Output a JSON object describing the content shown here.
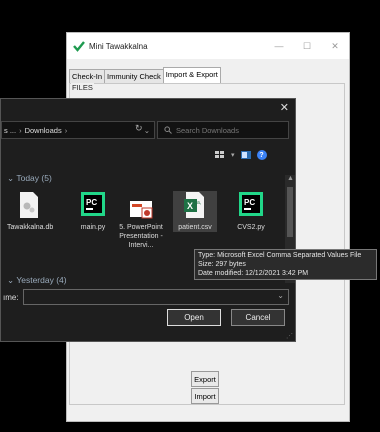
{
  "app": {
    "title": "Mini Tawakkalna",
    "tabs": [
      "Check-In",
      "Immunity Check",
      "Import & Export"
    ],
    "files_label": "FILES",
    "export_label": "Export",
    "import_label": "Import"
  },
  "dialog": {
    "breadcrumb_prefix": "s ...",
    "breadcrumb_folder": "Downloads",
    "search_placeholder": "Search Downloads",
    "group_today": "Today (5)",
    "group_yesterday": "Yesterday (4)",
    "files": [
      {
        "name": "Tawakkalna.db",
        "icon": "db-file-icon"
      },
      {
        "name": "main.py",
        "icon": "pycharm-icon"
      },
      {
        "name": "5. PowerPoint Presentation - Intervi...",
        "icon": "powerpoint-icon"
      },
      {
        "name": "patient.csv",
        "icon": "excel-csv-icon"
      },
      {
        "name": "CVS2.py",
        "icon": "pycharm-icon"
      }
    ],
    "filename_label": "ıme:",
    "open_label": "Open",
    "cancel_label": "Cancel"
  },
  "tooltip": {
    "type": "Type: Microsoft Excel Comma Separated Values File",
    "size": "Size: 297 bytes",
    "date": "Date modified: 12/12/2021 3:42 PM"
  },
  "colors": {
    "pycharm_green": "#21d789",
    "excel_green": "#1e7145",
    "help_blue": "#3b82f6"
  }
}
